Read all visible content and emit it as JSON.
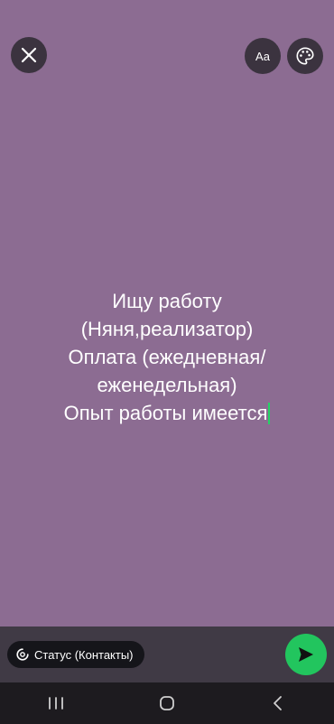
{
  "top_bar": {
    "font_button_label": "Aa"
  },
  "status": {
    "lines": [
      "Ищу работу",
      "(Няня,реализатор)",
      "Оплата (ежедневная/",
      "еженедельная)",
      "Опыт работы имеется"
    ],
    "background_color": "#8c6c92",
    "caret_color": "#25d366"
  },
  "bottom_bar": {
    "audience_label": "Статус (Контакты)",
    "send_button_color": "#22c55e"
  },
  "icons": {
    "close": "close-icon",
    "palette": "palette-icon",
    "audience": "status-icon",
    "send": "send-icon",
    "nav_recents": "recents-icon",
    "nav_home": "home-icon",
    "nav_back": "back-icon"
  }
}
